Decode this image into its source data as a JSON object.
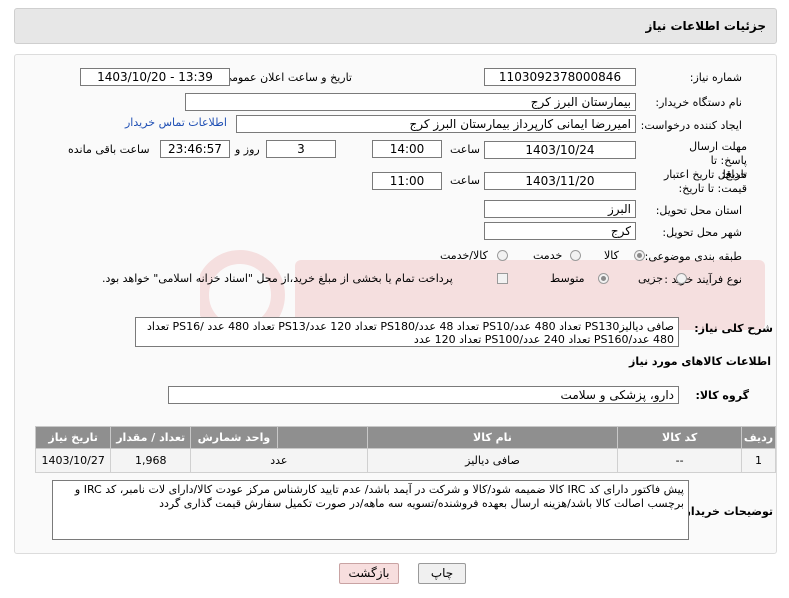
{
  "header": {
    "title": "جزئیات اطلاعات نیاز"
  },
  "fields": {
    "need_number_label": "شماره نیاز:",
    "need_number": "1103092378000846",
    "announce_label": "تاریخ و ساعت اعلان عمومی:",
    "announce_value": "1403/10/20 - 13:39",
    "buyer_org_label": "نام دستگاه خریدار:",
    "buyer_org": "بیمارستان البرز کرج",
    "requester_label": "ایجاد کننده درخواست:",
    "requester": "امیررضا ایمانی کارپرداز بیمارستان البرز کرج",
    "contact_link": "اطلاعات تماس خریدار",
    "deadline_label": "مهلت ارسال پاسخ: تا تاریخ:",
    "deadline_date": "1403/10/24",
    "time_label": "ساعت",
    "deadline_time": "14:00",
    "days_value": "3",
    "days_label": "روز و",
    "remaining_time": "23:46:57",
    "remaining_label": "ساعت باقی مانده",
    "validity_label": "حداقل تاریخ اعتبار قیمت: تا تاریخ:",
    "validity_date": "1403/11/20",
    "validity_time_label": "ساعت",
    "validity_time": "11:00",
    "province_label": "استان محل تحویل:",
    "province": "البرز",
    "city_label": "شهر محل تحویل:",
    "city": "کرج",
    "category_label": "طبقه بندی موضوعی:",
    "category_options": [
      "کالا",
      "خدمت",
      "کالا/خدمت"
    ],
    "process_label": "نوع فرآیند خرید :",
    "process_options": [
      "جزیی",
      "متوسط"
    ],
    "treasury_note": "پرداخت تمام یا بخشی از مبلغ خرید،از محل \"اسناد خزانه اسلامی\" خواهد بود."
  },
  "description": {
    "label": "شرح کلی نیاز:",
    "text": "صافی دیالیزPS130 تعداد 480 عدد/PS10 تعداد 48 عدد/PS180 تعداد 120 عدد/PS13 تعداد 480 عدد /PS16 تعداد 480 عدد/PS160 تعداد 240 عدد/PS100 تعداد 120 عدد"
  },
  "goods_info": {
    "title": "اطلاعات کالاهای مورد نیاز",
    "group_label": "گروه کالا:",
    "group_value": "دارو، پزشکی و سلامت"
  },
  "table": {
    "headers": [
      "ردیف",
      "کد کالا",
      "نام کالا",
      "واحد شمارش",
      "تعداد / مقدار",
      "تاریخ نیاز"
    ],
    "rows": [
      [
        "1",
        "--",
        "صافی دیالیز",
        "عدد",
        "1,968",
        "1403/10/27"
      ]
    ]
  },
  "notes": {
    "label": "توضیحات خریدار:",
    "text": "پیش فاکتور دارای کد IRC کالا ضمیمه شود/کالا و شرکت در آیمد باشد/ عدم تایید کارشناس مرکز عودت کالا/دارای لات نامبر، کد IRC و برچسب اصالت کالا باشد/هزینه ارسال بعهده فروشنده/تسویه سه ماهه/در صورت تکمیل سفارش قیمت گذاری گردد"
  },
  "buttons": {
    "print": "چاپ",
    "back": "بازگشت"
  },
  "colors": {
    "header_bg": "#e7e7e7",
    "table_header_bg": "#8f8f8f",
    "link": "#1f4fb4",
    "back_button_bg": "#f7dede"
  }
}
